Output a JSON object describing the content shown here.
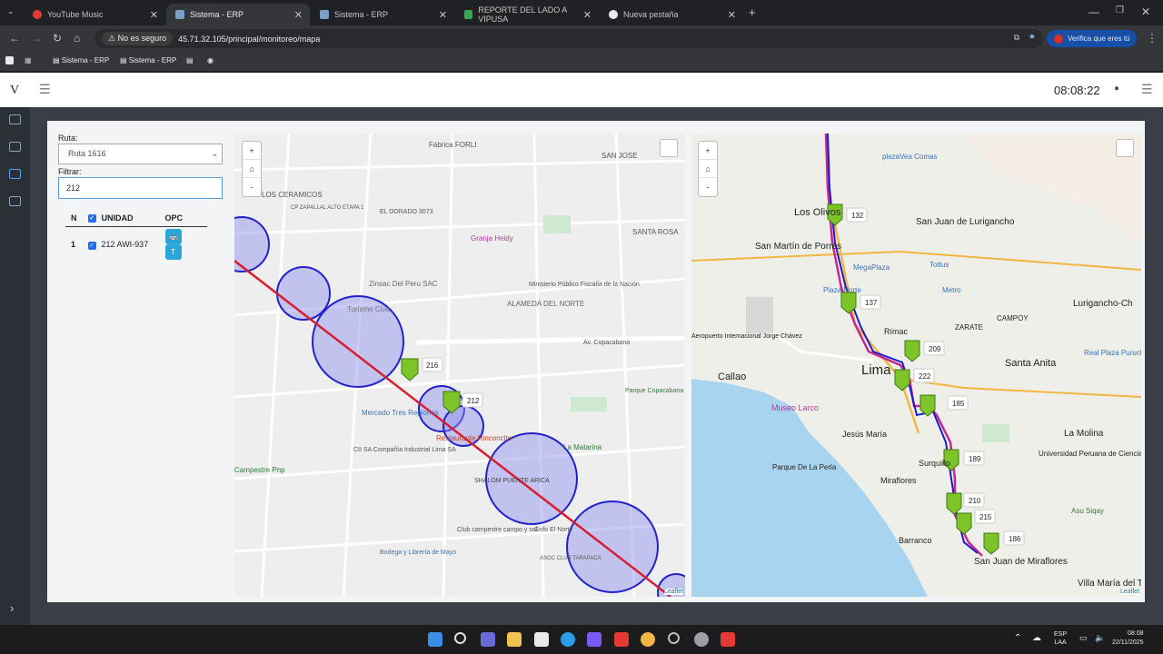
{
  "browser": {
    "tabs": [
      {
        "title": "YouTube Music",
        "active": false
      },
      {
        "title": "Sistema - ERP",
        "active": true
      },
      {
        "title": "Sistema - ERP",
        "active": false
      },
      {
        "title": "REPORTE DEL LADO A VIPUSA",
        "active": false
      },
      {
        "title": "Nueva pestaña",
        "active": false
      }
    ],
    "security_chip": "No es seguro",
    "url": "45.71.32.105/principal/monitoreo/mapa",
    "profile_button": "Verifica que eres tú",
    "bookmarks": [
      "Sistema - ERP",
      "Sistema - ERP"
    ]
  },
  "app": {
    "logo": "V",
    "clock": "08:08:22"
  },
  "form": {
    "route_label": "Ruta:",
    "route_value": "Ruta 1616",
    "filter_label": "Filtrar:",
    "filter_value": "212"
  },
  "table": {
    "headers": {
      "n": "N",
      "unit": "UNIDAD",
      "opc": "OPC"
    },
    "rows": [
      {
        "n": "1",
        "unit": "212 AWI-937",
        "btn2": "T"
      }
    ]
  },
  "map_left": {
    "zoom_in": "+",
    "home": "⌂",
    "zoom_out": "-",
    "attribution": "Leaflet",
    "labels": {
      "fabrica": "Fábrica FORLI",
      "san_jose": "SAN JOSE",
      "ceramicos": "LOS CERAMICOS",
      "zapallal": "CP ZAPALLAL ALTO ETAPA 1",
      "dorado": "EL DORADO 3073",
      "granja": "Granja Heidy",
      "santa_rosa": "SANTA ROSA",
      "zinsac": "Zinsac Del Peru SAC",
      "ministerio": "Ministerio Público Fiscalía de la Nación",
      "turismo": "Turismo Civa",
      "alameda": "ALAMEDA DEL NORTE",
      "copacabana": "Av. Copacabana",
      "mercado": "Mercado Tres Regiones",
      "restaurante": "Restaurante Rinconcito",
      "matarina": "La Matarina",
      "cii": "CII SA Compañía Industrial Lima SA",
      "campestre": "Campestre Pnp",
      "shalom": "SHALOM PUENTE ARICA",
      "club": "Club campestre campo y sol",
      "grifo": "Grifo El Norte",
      "bodega": "Bodega y Librería de Mayo",
      "tarapaca": "ASOC CLUB TARAPACA",
      "copacabana_park": "Parque Copacabana",
      "unit216": "216",
      "unit212": "212"
    }
  },
  "map_right": {
    "zoom_in": "+",
    "home": "⌂",
    "zoom_out": "-",
    "attribution": "Leaflet",
    "labels": {
      "los_olivos": "Los Olivos",
      "sjl": "San Juan de Lurigancho",
      "smp": "San Martín de Porres",
      "plaza_norte": "Plaza Norte",
      "megaplaza": "MegaPlaza",
      "tottus": "Tottus",
      "metro": "Metro",
      "lurigancho": "Lurigancho-Ch",
      "campoy": "CAMPOY",
      "zarate": "ZARATE",
      "rimac": "Rímac",
      "callao": "Callao",
      "lima": "Lima",
      "santa_anita": "Santa Anita",
      "real_plaza": "Real Plaza Puruchu",
      "museo_larco": "Museo Larco",
      "jesus_maria": "Jesús María",
      "la_molina": "La Molina",
      "parque_perla": "Parque De La Perla",
      "surquillo": "Surquillo",
      "miraflores": "Miraflores",
      "barranco": "Barranco",
      "sjm": "San Juan de Miraflores",
      "villa_maria": "Villa María del Triunfo",
      "upc": "Universidad Peruana de Ciencias Aplicadas",
      "plaza_vea": "plazaVea Comas",
      "asu_siqay": "Asu Siqay",
      "aeropuerto": "Aeropuerto Internacional Jorge Chávez",
      "u132": "132",
      "u137": "137",
      "u209": "209",
      "u222": "222",
      "u185": "185",
      "u189": "189",
      "u210": "210",
      "u215": "215",
      "u186": "186"
    }
  },
  "taskbar": {
    "lang": "ESP",
    "lang2": "LAA",
    "time": "08:08",
    "date": "22/11/2025"
  }
}
